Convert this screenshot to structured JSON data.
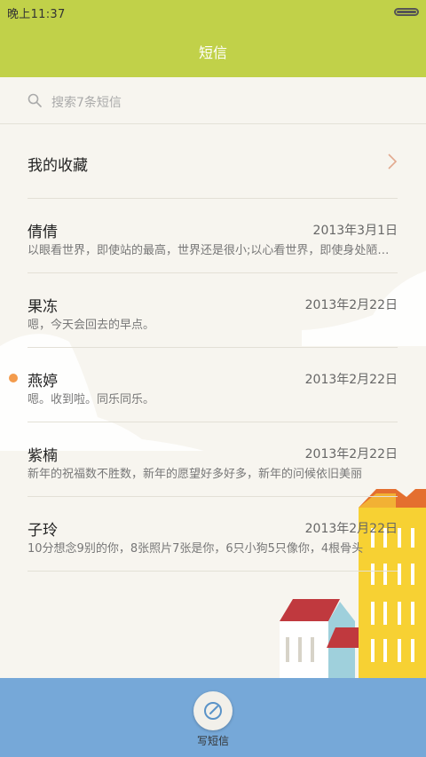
{
  "status_bar": {
    "time": "晚上11:37"
  },
  "header": {
    "title": "短信"
  },
  "search": {
    "placeholder": "搜索7条短信",
    "icon": "search-icon"
  },
  "favorites": {
    "label": "我的收藏",
    "icon": "chevron-right-icon"
  },
  "messages": [
    {
      "name": "倩倩",
      "date": "2013年3月1日",
      "preview": "以眼看世界，即使站的最高，世界还是很小;以心看世界，即使身处陋室，世界也很大",
      "unread": false
    },
    {
      "name": "果冻",
      "date": "2013年2月22日",
      "preview": "嗯，今天会回去的早点。",
      "unread": false
    },
    {
      "name": "燕婷",
      "date": "2013年2月22日",
      "preview": "嗯。收到啦。同乐同乐。",
      "unread": true
    },
    {
      "name": "紫楠",
      "date": "2013年2月22日",
      "preview": "新年的祝福数不胜数，新年的愿望好多好多，新年的问候依旧美丽",
      "unread": false
    },
    {
      "name": "子玲",
      "date": "2013年2月22日",
      "preview": "10分想念9别的你，8张照片7张是你，6只小狗5只像你，4根骨头",
      "unread": false
    }
  ],
  "bottom_bar": {
    "compose_label": "写短信",
    "icon": "edit-icon"
  },
  "colors": {
    "header": "#c1d149",
    "bottom": "#76a8d8",
    "unread_dot": "#f39b4c",
    "background": "#f7f5ef"
  }
}
